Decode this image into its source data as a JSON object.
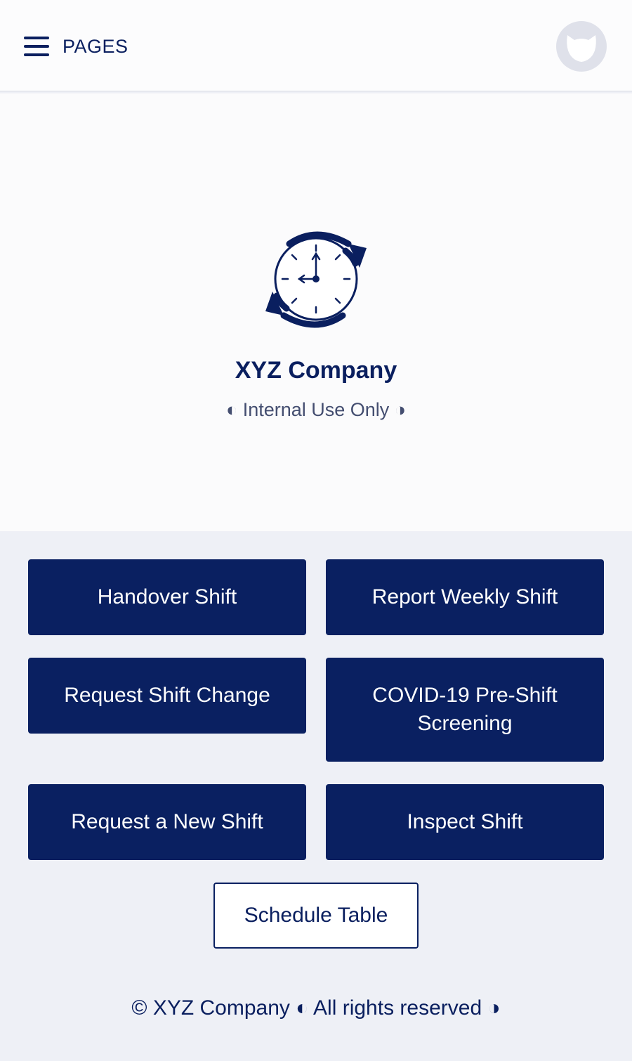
{
  "header": {
    "menu_icon": "hamburger-icon",
    "pages_label": "PAGES",
    "avatar_icon": "cat-avatar-icon"
  },
  "hero": {
    "logo_icon": "clock-refresh-icon",
    "company_name": "XYZ Company",
    "subtitle": "◐ Internal Use Only ◑"
  },
  "buttons": {
    "handover": "Handover Shift",
    "weekly": "Report Weekly Shift",
    "change": "Request Shift Change",
    "covid": "COVID-19 Pre-Shift Screening",
    "new_shift": "Request a New Shift",
    "inspect": "Inspect Shift",
    "schedule": "Schedule Table"
  },
  "footer": {
    "text": "© XYZ Company ◐ All rights reserved ◑"
  },
  "colors": {
    "primary": "#0a2061",
    "background": "#eef0f6",
    "hero_background": "#fbfbfc"
  }
}
